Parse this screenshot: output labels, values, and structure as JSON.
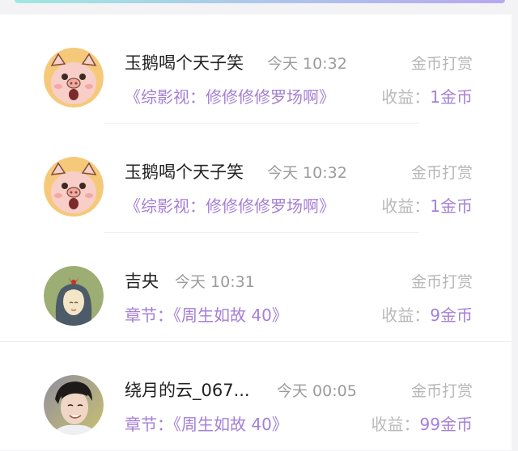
{
  "items": [
    {
      "name": "玉鹅喝个天子笑",
      "time": "今天 10:32",
      "action": "金币打赏",
      "work_prefix": "",
      "work": "《综影视：修修修修罗场啊》",
      "earn_label": "收益：",
      "earn_value": "1金币",
      "avatar": "pig-avatar-icon"
    },
    {
      "name": "玉鹅喝个天子笑",
      "time": "今天 10:32",
      "action": "金币打赏",
      "work_prefix": "",
      "work": "《综影视：修修修修罗场啊》",
      "earn_label": "收益：",
      "earn_value": "1金币",
      "avatar": "pig-avatar-icon"
    },
    {
      "name": "吉央",
      "time": "今天 10:31",
      "action": "金币打赏",
      "work_prefix": "章节：",
      "work": "《周生如故 40》",
      "earn_label": "收益：",
      "earn_value": "9金币",
      "avatar": "girl-avatar-icon"
    },
    {
      "name": "绕月的云_067...",
      "time": "今天 00:05",
      "action": "金币打赏",
      "work_prefix": "章节：",
      "work": "《周生如故 40》",
      "earn_label": "收益：",
      "earn_value": "99金币",
      "avatar": "person-photo-avatar"
    }
  ],
  "colors": {
    "accent": "#a57fd6",
    "background": "#f3f3f5",
    "muted": "#9b9b9b"
  }
}
